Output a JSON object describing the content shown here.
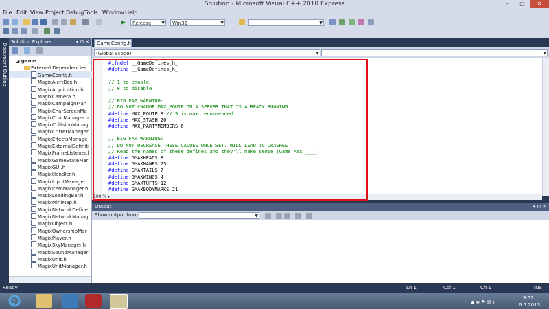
{
  "window": {
    "title": "Solution - Microsoft Visual C++ 2010 Express"
  },
  "menu": [
    "File",
    "Edit",
    "View",
    "Project",
    "Debug",
    "Tools",
    "Window",
    "Help"
  ],
  "toolbar": {
    "config": "Release",
    "platform": "Win32",
    "search": ""
  },
  "solution_explorer": {
    "title": "Solution Explorer",
    "root": "game",
    "folder": "External Dependencies",
    "files": [
      "GameConfig.h",
      "MagixAlertBox.h",
      "MagixApplication.h",
      "MagixCamera.h",
      "MagixCampaignMan",
      "MagixCharScreenMa",
      "MagixChatManager.h",
      "MagixCollisionManag",
      "MagixCritterManager",
      "MagixEffectsManage",
      "MagixExternalDefiniti",
      "MagixFrameListener.l",
      "MagixGameStateMar",
      "MagixGUI.h",
      "MagixHandler.h",
      "MagixInputManager.",
      "MagixItemManager.h",
      "MagixLoadingBar.h",
      "MagixMiniMap.h",
      "MagixNetworkDefine",
      "MagixNetworkManag",
      "MagixObject.h",
      "MagixOwnershipMar",
      "MagixPlayer.h",
      "MagixSkyManager.h",
      "MagixSoundManager",
      "MagixUnit.h",
      "MagixUnitManager.h"
    ]
  },
  "document_outline_label": "Document Outline",
  "editor": {
    "tab": "GameConfig.h",
    "scope": "(Global Scope)",
    "zoom": "100 %",
    "lines": [
      [
        {
          "t": "kw",
          "v": "#ifndef"
        },
        {
          "t": "tx",
          "v": " __GameDefines_h_"
        }
      ],
      [
        {
          "t": "kw",
          "v": "#define"
        },
        {
          "t": "tx",
          "v": " __GameDefines_h_"
        }
      ],
      [],
      [
        {
          "t": "cm",
          "v": "// 1 to enable"
        }
      ],
      [
        {
          "t": "cm",
          "v": "// 0 to disable"
        }
      ],
      [],
      [
        {
          "t": "cm",
          "v": "// BIG FAT WARNING:"
        }
      ],
      [
        {
          "t": "cm",
          "v": "// DO NOT CHANGE MAX_EQUIP ON A SERVER THAT IS ALREADY RUNNING"
        }
      ],
      [
        {
          "t": "kw",
          "v": "#define"
        },
        {
          "t": "tx",
          "v": " MAX_EQUIP 8 "
        },
        {
          "t": "cm",
          "v": "// 9 is max recommended"
        }
      ],
      [
        {
          "t": "kw",
          "v": "#define"
        },
        {
          "t": "tx",
          "v": " MAX_STASH 20"
        }
      ],
      [
        {
          "t": "kw",
          "v": "#define"
        },
        {
          "t": "tx",
          "v": " MAX_PARTYMEMBERS 6"
        }
      ],
      [],
      [
        {
          "t": "cm",
          "v": "// BIG FAT WARNING:"
        }
      ],
      [
        {
          "t": "cm",
          "v": "// DO NOT DECREASE THESE VALUES ONCE SET. WILL LEAD TO CRASHES"
        }
      ],
      [
        {
          "t": "cm",
          "v": "// Read the names of these defines and they'll make sense (Game Max ____)"
        }
      ],
      [
        {
          "t": "kw",
          "v": "#define"
        },
        {
          "t": "tx",
          "v": " GMAXHEADS 8"
        }
      ],
      [
        {
          "t": "kw",
          "v": "#define"
        },
        {
          "t": "tx",
          "v": " GMAXMANES 25"
        }
      ],
      [
        {
          "t": "kw",
          "v": "#define"
        },
        {
          "t": "tx",
          "v": " GMAXTAILS 7"
        }
      ],
      [
        {
          "t": "kw",
          "v": "#define"
        },
        {
          "t": "tx",
          "v": " GMAXWINGS 4"
        }
      ],
      [
        {
          "t": "kw",
          "v": "#define"
        },
        {
          "t": "tx",
          "v": " GMAXTUFTS 12"
        }
      ],
      [
        {
          "t": "kw",
          "v": "#define"
        },
        {
          "t": "tx",
          "v": " GMAXBODYMARKS 21"
        }
      ]
    ]
  },
  "output": {
    "title": "Output",
    "show_from_label": "Show output from:",
    "show_from_value": ""
  },
  "status": {
    "ready": "Ready",
    "ln": "Ln 1",
    "col": "Col 1",
    "ch": "Ch 1",
    "ins": "INS"
  },
  "taskbar": {
    "time": "9:52",
    "date": "6.5.2013"
  }
}
